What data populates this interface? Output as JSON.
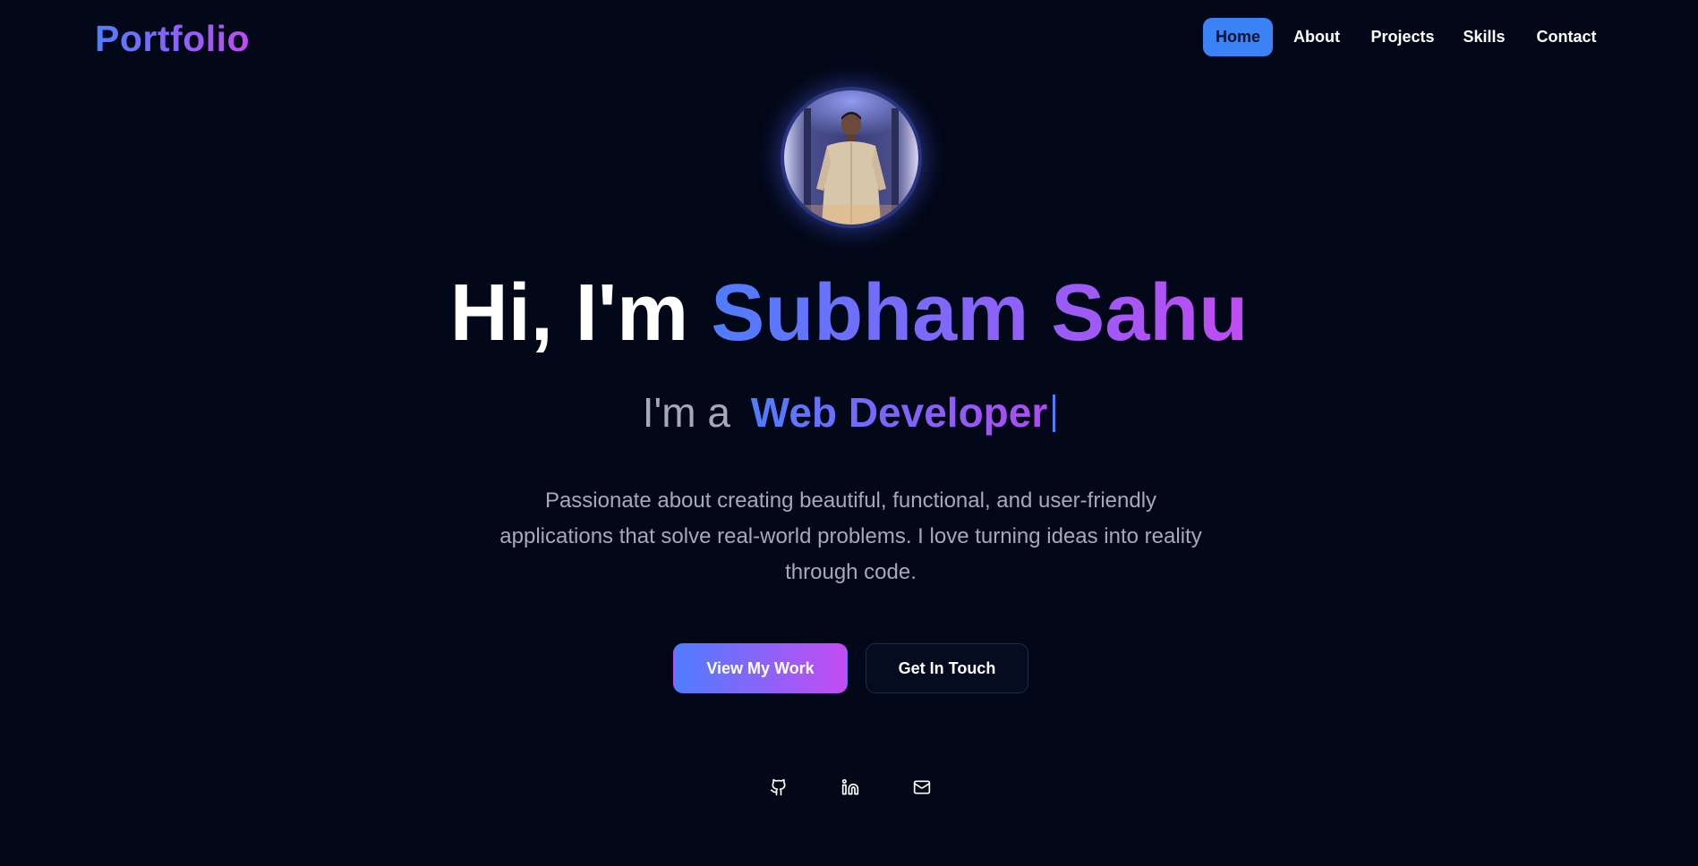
{
  "nav": {
    "brand": "Portfolio",
    "links": [
      {
        "label": "Home",
        "active": true
      },
      {
        "label": "About",
        "active": false
      },
      {
        "label": "Projects",
        "active": false
      },
      {
        "label": "Skills",
        "active": false
      },
      {
        "label": "Contact",
        "active": false
      }
    ]
  },
  "hero": {
    "avatar_alt": "profile-photo",
    "greeting": "Hi, I'm",
    "name": "Subham Sahu",
    "role_prefix": "I'm a",
    "role": "Web Developer",
    "description_lines": [
      "Passionate about creating beautiful, functional, and user-friendly",
      "applications that solve real-world problems. I love turning ideas into reality",
      "through code."
    ],
    "primary_cta": "View My Work",
    "secondary_cta": "Get In Touch"
  },
  "socials": [
    {
      "icon": "github-icon"
    },
    {
      "icon": "linkedin-icon"
    },
    {
      "icon": "mail-icon"
    }
  ],
  "colors": {
    "background": "#030818",
    "accent_blue": "#3b82f6",
    "gradient_start": "#4f7dff",
    "gradient_end": "#c14bf2",
    "muted_text": "#a3aab8"
  }
}
